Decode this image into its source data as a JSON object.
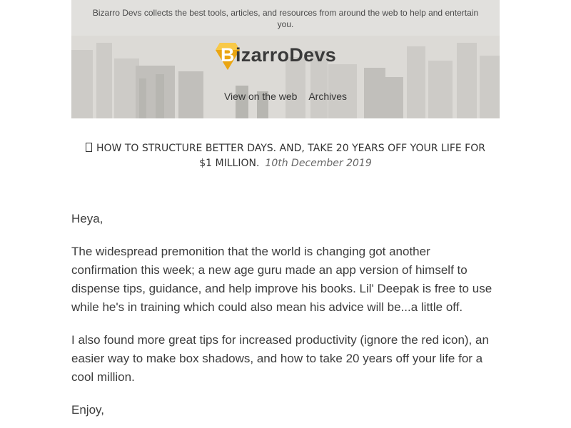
{
  "header": {
    "tagline": "Bizarro Devs collects the best tools, articles, and resources from around the web to help and entertain you.",
    "logo_first": "B",
    "logo_rest": "izarroDevs",
    "logo_text": "BizarroDevs",
    "links": [
      {
        "label": "View on the web"
      },
      {
        "label": "Archives"
      }
    ],
    "accent_color": "#f5b820"
  },
  "issue": {
    "title": "HOW TO STRUCTURE BETTER DAYS. AND, TAKE 20 YEARS OFF YOUR LIFE FOR $1 MILLION.",
    "date": "10th December 2019",
    "icon": "unrendered-emoji-box"
  },
  "body": {
    "greeting": "Heya,",
    "paragraphs": [
      "The widespread premonition that the world is changing got another confirmation this week; a new age guru made an app version of himself to dispense tips, guidance, and help improve his books. Lil' Deepak is free to use while he's in training which could also mean his advice will be...a little off.",
      "I also found more great tips for increased productivity (ignore the red icon), an easier way to make box shadows, and how to take 20 years off your life for a cool million."
    ],
    "signoff": "Enjoy,"
  }
}
